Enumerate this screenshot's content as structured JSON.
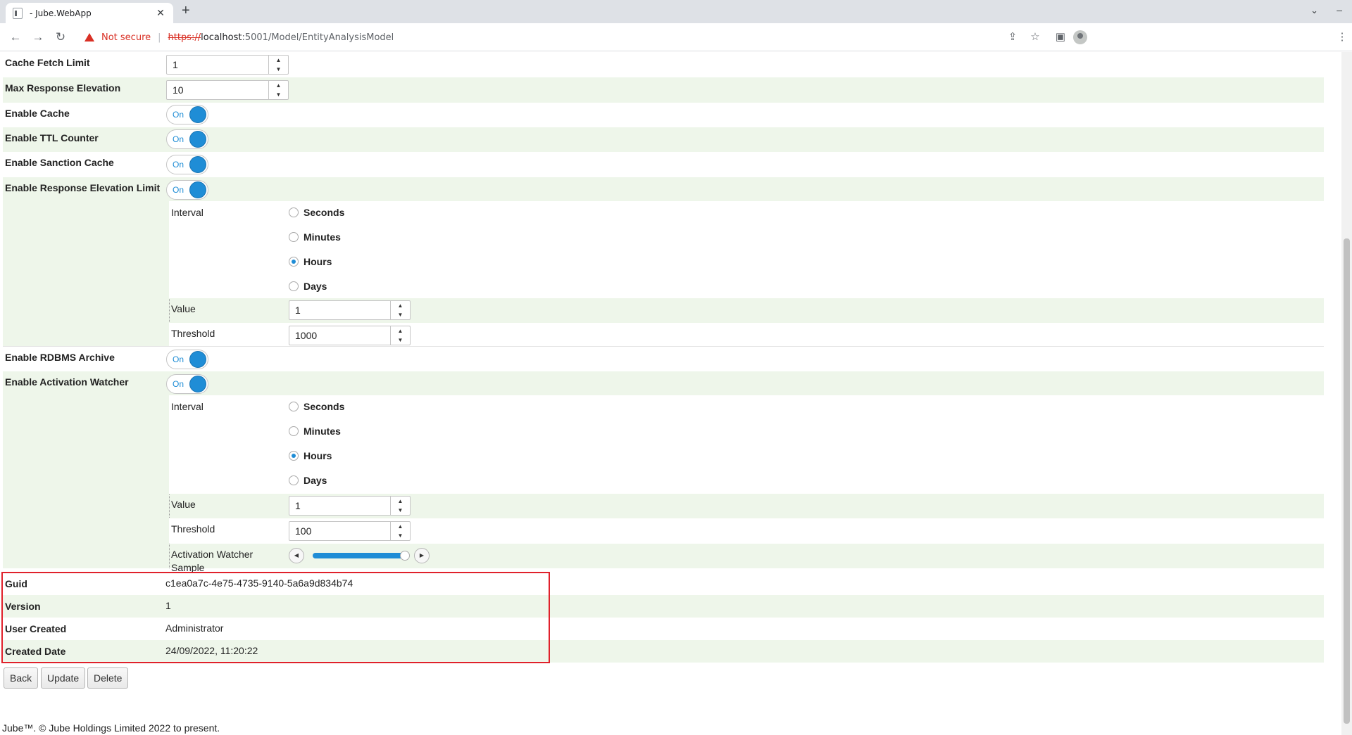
{
  "browser": {
    "tab_title": "- Jube.WebApp",
    "tab_close": "✕",
    "new_tab": "+",
    "tab_menu": "⌄",
    "minimize": "–",
    "back": "←",
    "forward": "→",
    "reload": "↻",
    "not_secure": "Not secure",
    "separator": "|",
    "url_scheme": "https://",
    "url_host": "localhost",
    "url_path": ":5001/Model/EntityAnalysisModel",
    "share_icon": "⇪",
    "star_icon": "☆",
    "sidepanel_icon": "▣",
    "menu_icon": "⋮"
  },
  "form": {
    "cache_fetch_limit": {
      "label": "Cache Fetch Limit",
      "value": "1"
    },
    "max_response_elevation": {
      "label": "Max Response Elevation",
      "value": "10"
    },
    "enable_cache": {
      "label": "Enable Cache",
      "state": "On"
    },
    "enable_ttl_counter": {
      "label": "Enable TTL Counter",
      "state": "On"
    },
    "enable_sanction_cache": {
      "label": "Enable Sanction Cache",
      "state": "On"
    },
    "enable_response_elevation_limit": {
      "label": "Enable Response Elevation Limit",
      "state": "On",
      "interval_label": "Interval",
      "options": [
        "Seconds",
        "Minutes",
        "Hours",
        "Days"
      ],
      "selected": "Hours",
      "value_label": "Value",
      "value": "1",
      "threshold_label": "Threshold",
      "threshold": "1000"
    },
    "enable_rdbms_archive": {
      "label": "Enable RDBMS Archive",
      "state": "On"
    },
    "enable_activation_watcher": {
      "label": "Enable Activation Watcher",
      "state": "On",
      "interval_label": "Interval",
      "options": [
        "Seconds",
        "Minutes",
        "Hours",
        "Days"
      ],
      "selected": "Hours",
      "value_label": "Value",
      "value": "1",
      "threshold_label": "Threshold",
      "threshold": "100",
      "sample_label_line1": "Activation Watcher",
      "sample_label_line2": "Sample",
      "sample_level": 1.0
    }
  },
  "info": {
    "guid_label": "Guid",
    "guid": "c1ea0a7c-4e75-4735-9140-5a6a9d834b74",
    "version_label": "Version",
    "version": "1",
    "user_created_label": "User Created",
    "user_created": "Administrator",
    "created_date_label": "Created Date",
    "created_date": "24/09/2022, 11:20:22"
  },
  "actions": {
    "back": "Back",
    "update": "Update",
    "delete": "Delete"
  },
  "footer": "Jube™. © Jube Holdings Limited 2022 to present."
}
